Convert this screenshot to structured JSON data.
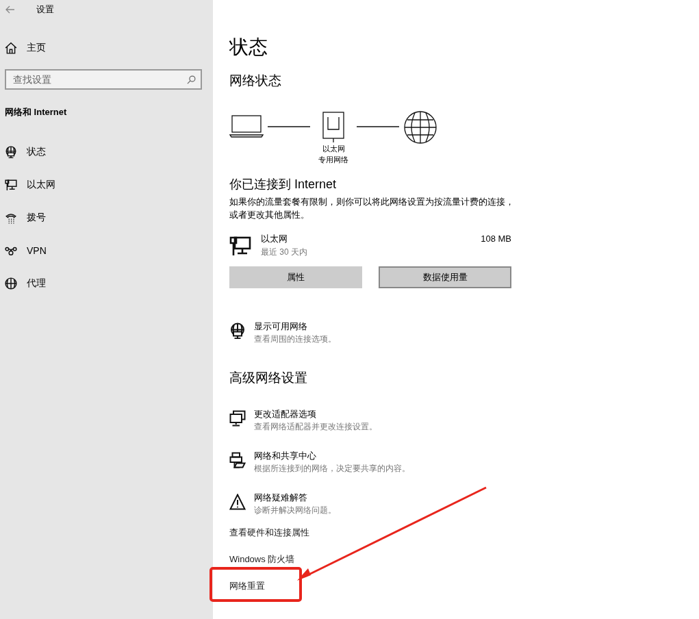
{
  "window": {
    "title": "设置"
  },
  "sidebar": {
    "home": "主页",
    "search": {
      "placeholder": "查找设置"
    },
    "section": "网络和 Internet",
    "items": [
      {
        "label": "状态"
      },
      {
        "label": "以太网"
      },
      {
        "label": "拨号"
      },
      {
        "label": "VPN"
      },
      {
        "label": "代理"
      }
    ]
  },
  "main": {
    "title": "状态",
    "network_status": "网络状态",
    "diagram": {
      "adapter": "以太网",
      "profile": "专用网络"
    },
    "connected_title": "你已连接到 Internet",
    "connected_text": "如果你的流量套餐有限制，则你可以将此网络设置为按流量计费的连接，或者更改其他属性。",
    "connection": {
      "name": "以太网",
      "period": "最近 30 天内",
      "usage": "108 MB"
    },
    "buttons": [
      {
        "label": "属性",
        "focused": false
      },
      {
        "label": "数据使用量",
        "focused": true
      }
    ],
    "show_networks": {
      "title": "显示可用网络",
      "subtitle": "查看周围的连接选项。"
    },
    "advanced_title": "高级网络设置",
    "advanced_items": [
      {
        "title": "更改适配器选项",
        "subtitle": "查看网络适配器并更改连接设置。"
      },
      {
        "title": "网络和共享中心",
        "subtitle": "根据所连接到的网络，决定要共享的内容。"
      },
      {
        "title": "网络疑难解答",
        "subtitle": "诊断并解决网络问题。"
      }
    ],
    "links": [
      "查看硬件和连接属性",
      "Windows 防火墙",
      "网络重置"
    ]
  }
}
